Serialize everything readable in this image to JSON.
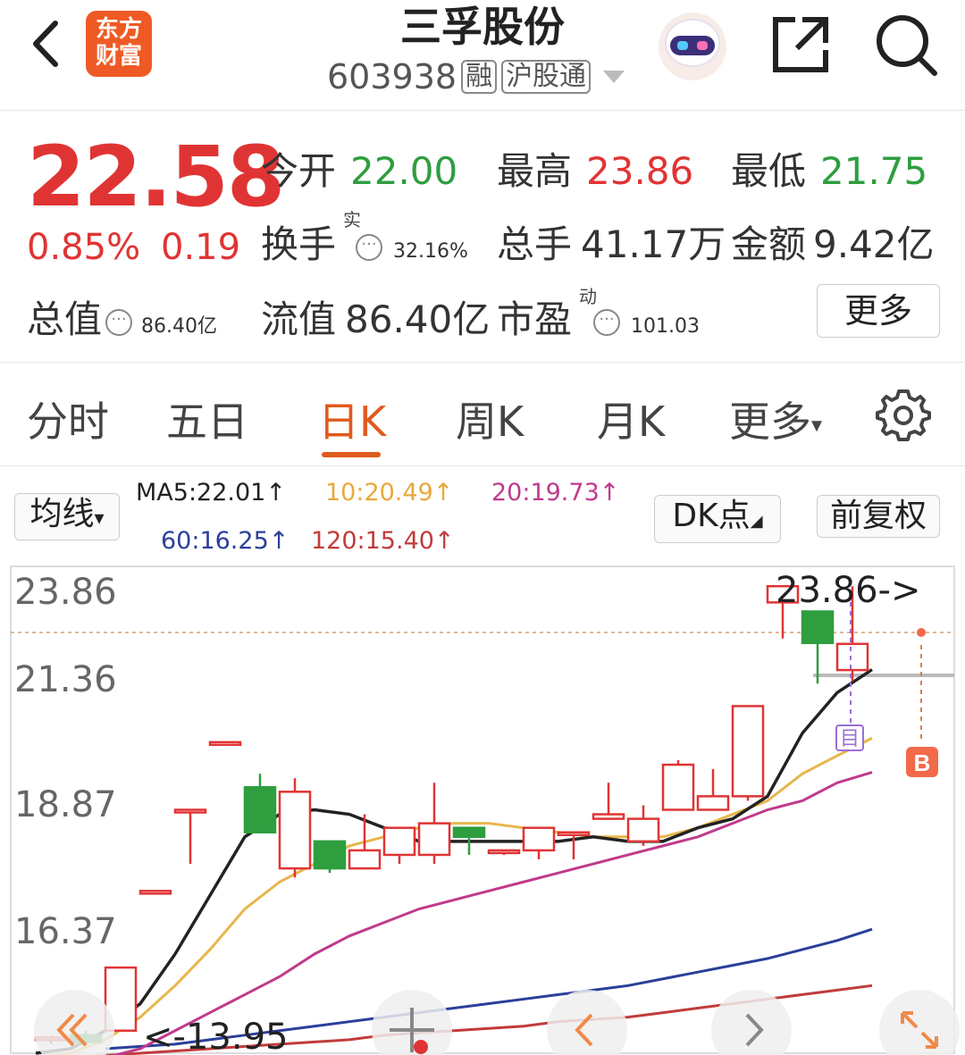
{
  "header": {
    "logo_line1": "东方",
    "logo_line2": "财富",
    "title": "三孚股份",
    "code": "603938",
    "tags": [
      "融",
      "沪股通"
    ]
  },
  "quote": {
    "price": "22.58",
    "change_pct": "0.85%",
    "change": "0.19",
    "open_label": "今开",
    "open": "22.00",
    "high_label": "最高",
    "high": "23.86",
    "low_label": "最低",
    "low": "21.75",
    "turnover_label": "换手",
    "turnover_sup": "实",
    "turnover": "32.16%",
    "volume_label": "总手",
    "volume": "41.17万",
    "amount_label": "金额",
    "amount": "9.42亿",
    "mcap_label": "总值",
    "mcap": "86.40亿",
    "float_label": "流值",
    "float": "86.40亿",
    "pe_label": "市盈",
    "pe_sup": "动",
    "pe": "101.03",
    "more": "更多"
  },
  "tabs": [
    "分时",
    "五日",
    "日K",
    "周K",
    "月K",
    "更多"
  ],
  "active_tab": "日K",
  "ma_bar": {
    "ma_select": "均线",
    "ma5": "MA5:22.01↑",
    "ma10": "10:20.49↑",
    "ma20": "20:19.73↑",
    "ma60": "60:16.25↑",
    "ma120": "120:15.40↑",
    "dk": "DK点",
    "adjust": "前复权"
  },
  "colors": {
    "up": "#e03434",
    "down": "#2e9e3f",
    "accent": "#e05a1c",
    "ma5": "#222222",
    "ma10": "#e8b64c",
    "ma20": "#c03a8c",
    "ma60": "#2a3f9a",
    "ma120": "#c23b3b"
  },
  "chart_data": {
    "type": "candlestick",
    "y_ticks": [
      "23.86",
      "21.36",
      "18.87",
      "16.37"
    ],
    "ylim": [
      13.5,
      24.3
    ],
    "high_marker": "23.86->",
    "low_marker": "13.95",
    "candles": [
      {
        "o": 13.8,
        "c": 13.85,
        "h": 13.9,
        "l": 13.7
      },
      {
        "o": 13.9,
        "c": 13.75,
        "h": 14.0,
        "l": 13.7
      },
      {
        "o": 14.0,
        "c": 15.4,
        "h": 15.4,
        "l": 14.0
      },
      {
        "o": 17.1,
        "c": 17.1,
        "h": 17.1,
        "l": 17.1
      },
      {
        "o": 18.9,
        "c": 18.9,
        "h": 18.9,
        "l": 17.7
      },
      {
        "o": 20.4,
        "c": 20.4,
        "h": 20.4,
        "l": 20.4
      },
      {
        "o": 19.4,
        "c": 18.4,
        "h": 19.7,
        "l": 18.4
      },
      {
        "o": 17.6,
        "c": 19.3,
        "h": 19.6,
        "l": 17.4
      },
      {
        "o": 18.2,
        "c": 17.6,
        "h": 18.2,
        "l": 17.5
      },
      {
        "o": 17.6,
        "c": 18.0,
        "h": 18.8,
        "l": 17.6
      },
      {
        "o": 17.9,
        "c": 18.5,
        "h": 18.5,
        "l": 17.7
      },
      {
        "o": 17.9,
        "c": 18.6,
        "h": 19.5,
        "l": 17.7
      },
      {
        "o": 18.5,
        "c": 18.3,
        "h": 18.5,
        "l": 17.9
      },
      {
        "o": 18.0,
        "c": 18.0,
        "h": 18.0,
        "l": 17.9
      },
      {
        "o": 18.0,
        "c": 18.5,
        "h": 18.5,
        "l": 17.8
      },
      {
        "o": 18.4,
        "c": 18.4,
        "h": 18.4,
        "l": 17.8
      },
      {
        "o": 18.7,
        "c": 18.8,
        "h": 19.5,
        "l": 18.7
      },
      {
        "o": 18.2,
        "c": 18.7,
        "h": 19.0,
        "l": 18.1
      },
      {
        "o": 18.9,
        "c": 19.9,
        "h": 20.0,
        "l": 18.9
      },
      {
        "o": 18.9,
        "c": 19.2,
        "h": 19.8,
        "l": 18.9
      },
      {
        "o": 19.2,
        "c": 21.2,
        "h": 21.2,
        "l": 19.1
      },
      {
        "o": 23.5,
        "c": 23.86,
        "h": 23.86,
        "l": 22.7
      },
      {
        "o": 23.3,
        "c": 22.6,
        "h": 23.3,
        "l": 21.7
      },
      {
        "o": 22.0,
        "c": 22.58,
        "h": 23.86,
        "l": 21.75
      }
    ],
    "ma5": [
      13.5,
      13.6,
      14.0,
      14.6,
      15.7,
      17.0,
      18.3,
      18.8,
      18.9,
      18.8,
      18.5,
      18.2,
      18.2,
      18.2,
      18.2,
      18.2,
      18.3,
      18.2,
      18.2,
      18.5,
      18.7,
      19.2,
      20.6,
      21.5,
      22.01
    ],
    "ma10": [
      13.4,
      13.5,
      13.8,
      14.3,
      15.0,
      15.8,
      16.7,
      17.3,
      17.7,
      18.1,
      18.3,
      18.5,
      18.6,
      18.6,
      18.5,
      18.4,
      18.3,
      18.3,
      18.3,
      18.5,
      18.8,
      19.1,
      19.7,
      20.1,
      20.49
    ],
    "ma20": [
      13.3,
      13.4,
      13.6,
      14.0,
      14.4,
      14.8,
      15.2,
      15.7,
      16.1,
      16.4,
      16.7,
      16.9,
      17.1,
      17.3,
      17.5,
      17.7,
      17.9,
      18.1,
      18.3,
      18.6,
      18.9,
      19.1,
      19.5,
      19.73
    ],
    "ma60": [
      13.6,
      13.65,
      13.7,
      13.8,
      13.9,
      14.0,
      14.1,
      14.2,
      14.3,
      14.4,
      14.5,
      14.6,
      14.7,
      14.8,
      14.9,
      15.0,
      15.15,
      15.3,
      15.45,
      15.6,
      15.8,
      16.0,
      16.25
    ],
    "ma120": [
      13.4,
      13.45,
      13.5,
      13.55,
      13.6,
      13.65,
      13.7,
      13.75,
      13.8,
      13.9,
      13.95,
      14.0,
      14.05,
      14.1,
      14.2,
      14.25,
      14.3,
      14.4,
      14.5,
      14.6,
      14.7,
      14.8,
      14.9,
      15.0
    ]
  }
}
